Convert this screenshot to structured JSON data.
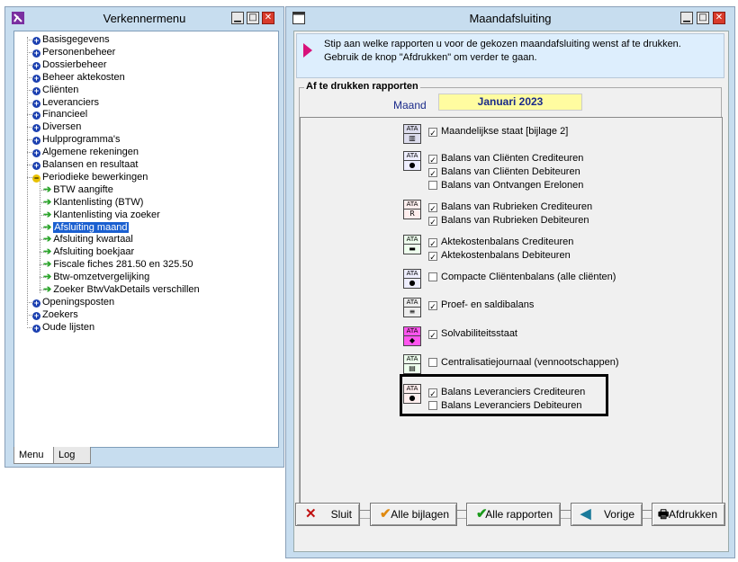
{
  "left_window": {
    "title": "Verkennermenu",
    "tree": [
      {
        "label": "Basisgegevens",
        "type": "plus"
      },
      {
        "label": "Personenbeheer",
        "type": "plus"
      },
      {
        "label": "Dossierbeheer",
        "type": "plus"
      },
      {
        "label": "Beheer aktekosten",
        "type": "plus"
      },
      {
        "label": "Cliënten",
        "type": "plus"
      },
      {
        "label": "Leveranciers",
        "type": "plus"
      },
      {
        "label": "Financieel",
        "type": "plus"
      },
      {
        "label": "Diversen",
        "type": "plus"
      },
      {
        "label": "Hulpprogramma's",
        "type": "plus"
      },
      {
        "label": "Algemene rekeningen",
        "type": "plus"
      },
      {
        "label": "Balansen en resultaat",
        "type": "plus"
      },
      {
        "label": "Periodieke bewerkingen",
        "type": "minus"
      },
      {
        "label": "BTW aangifte",
        "type": "child"
      },
      {
        "label": "Klantenlisting (BTW)",
        "type": "child"
      },
      {
        "label": "Klantenlisting via zoeker",
        "type": "child"
      },
      {
        "label": "Afsluiting maand",
        "type": "child",
        "selected": true
      },
      {
        "label": "Afsluiting kwartaal",
        "type": "child"
      },
      {
        "label": "Afsluiting boekjaar",
        "type": "child"
      },
      {
        "label": "Fiscale fiches 281.50 en 325.50",
        "type": "child"
      },
      {
        "label": "Btw-omzetvergelijking",
        "type": "child"
      },
      {
        "label": "Zoeker BtwVakDetails verschillen",
        "type": "child"
      },
      {
        "label": "Openingsposten",
        "type": "plus"
      },
      {
        "label": "Zoekers",
        "type": "plus"
      },
      {
        "label": "Oude lijsten",
        "type": "plus"
      }
    ],
    "tabs": [
      "Menu",
      "Log"
    ]
  },
  "right_window": {
    "title": "Maandafsluiting",
    "info_line1": "Stip aan welke rapporten u voor de gekozen maandafsluiting wenst af te drukken.",
    "info_line2": "Gebruik de knop \"Afdrukken\" om verder te gaan.",
    "group_label": "Af te drukken rapporten",
    "maand_label": "Maand",
    "maand_value": "Januari 2023",
    "reports": [
      {
        "label": "Maandelijkse staat [bijlage 2]",
        "checked": true
      },
      {
        "label": "Balans van Cliënten Crediteuren",
        "checked": true
      },
      {
        "label": "Balans van Cliënten Debiteuren",
        "checked": true
      },
      {
        "label": "Balans van Ontvangen Erelonen",
        "checked": false
      },
      {
        "label": "Balans van Rubrieken Crediteuren",
        "checked": true
      },
      {
        "label": "Balans van Rubrieken Debiteuren",
        "checked": true
      },
      {
        "label": "Aktekostenbalans Crediteuren",
        "checked": true
      },
      {
        "label": "Aktekostenbalans Debiteuren",
        "checked": true
      },
      {
        "label": "Compacte Cliëntenbalans (alle cliënten)",
        "checked": false
      },
      {
        "label": "Proef- en saldibalans",
        "checked": true
      },
      {
        "label": "Solvabiliteitsstaat",
        "checked": true
      },
      {
        "label": "Centralisatiejournaal (vennootschappen)",
        "checked": false
      },
      {
        "label": "Balans Leveranciers Crediteuren",
        "checked": true
      },
      {
        "label": "Balans Leveranciers Debiteuren",
        "checked": false
      }
    ],
    "buttons": {
      "sluit": "Sluit",
      "alle_bijlagen": "Alle bijlagen",
      "alle_rapporten": "Alle rapporten",
      "vorige": "Vorige",
      "afdrukken": "Afdrukken"
    }
  },
  "colors": {
    "window_bg": "#c7ddef",
    "selection": "#1a5fd0",
    "accent_arrow": "#d8117a",
    "month_bg": "#fffca0"
  }
}
